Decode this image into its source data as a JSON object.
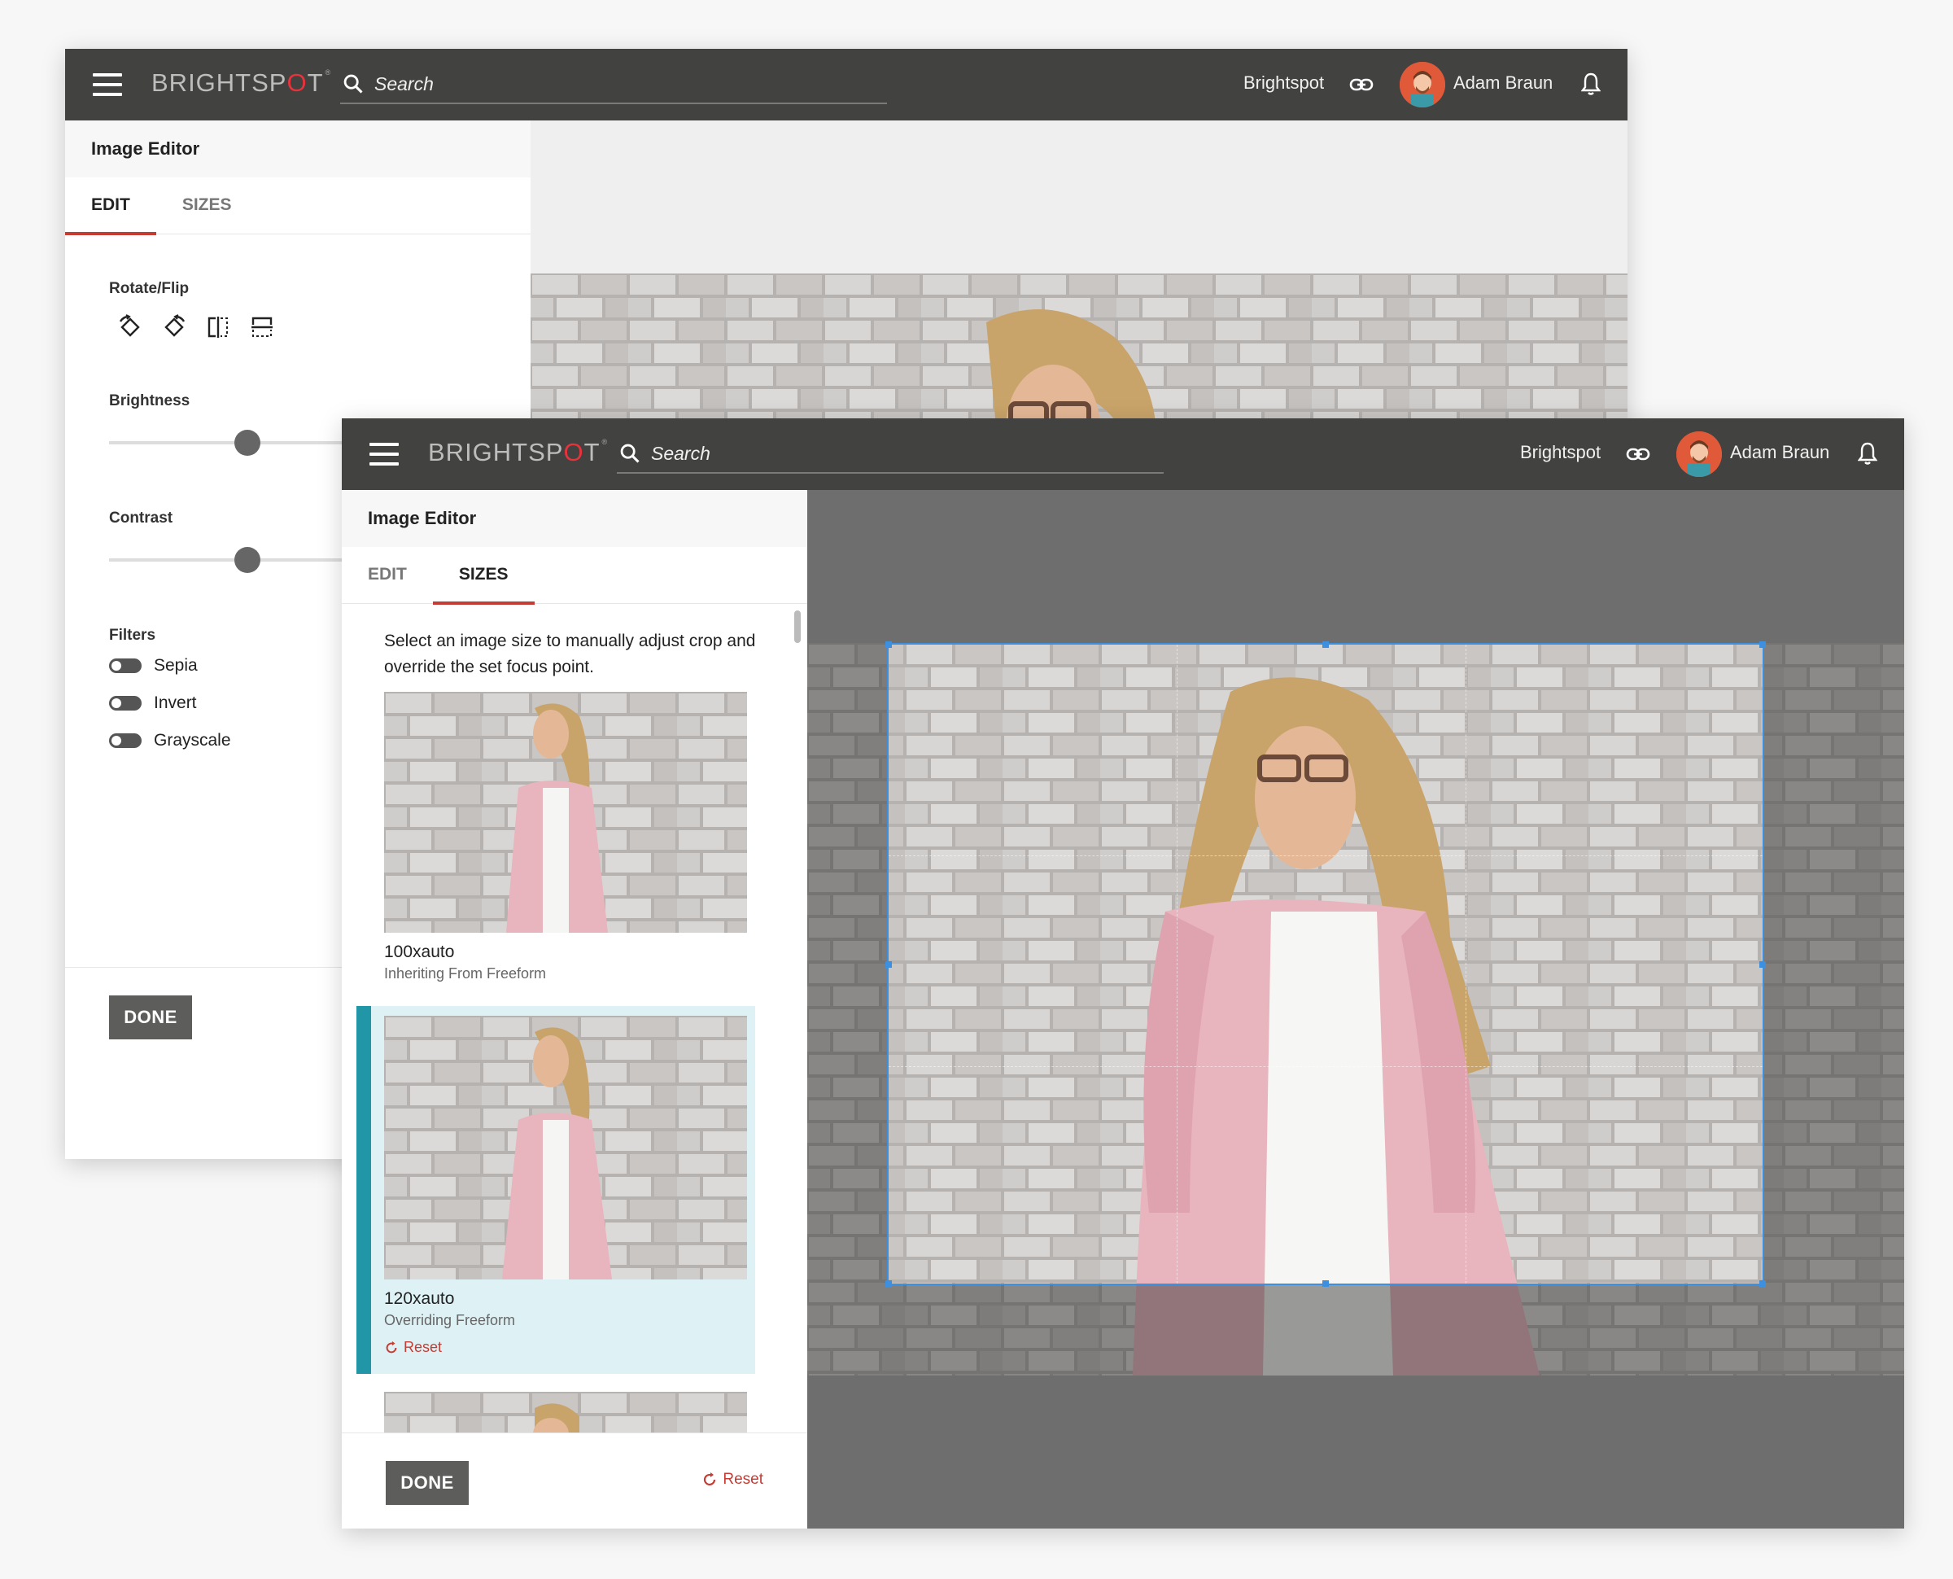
{
  "topbar": {
    "logo_prefix": "BRIGHTSP",
    "logo_o": "O",
    "logo_suffix": "T",
    "logo_mark": "®",
    "search_placeholder": "Search",
    "site_name": "Brightspot",
    "user_name": "Adam Braun"
  },
  "editor": {
    "title": "Image Editor",
    "tabs": [
      "EDIT",
      "SIZES"
    ],
    "rotate_label": "Rotate/Flip",
    "brightness_label": "Brightness",
    "brightness_value": 0.5,
    "contrast_label": "Contrast",
    "contrast_value": 0.5,
    "filters_label": "Filters",
    "filters": [
      "Sepia",
      "Invert",
      "Grayscale"
    ],
    "done_label": "DONE",
    "reset_label": "Reset"
  },
  "sizes": {
    "intro": "Select an image size to manually adjust crop and override the set focus point.",
    "items": [
      {
        "title": "100xauto",
        "subtitle": "Inheriting From Freeform"
      },
      {
        "title": "120xauto",
        "subtitle": "Overriding Freeform",
        "reset": "Reset"
      }
    ]
  },
  "icons": {
    "menu": "hamburger-icon",
    "search": "search-icon",
    "link": "link-icon",
    "bell": "bell-icon",
    "rotate_left": "rotate-left-icon",
    "rotate_right": "rotate-right-icon",
    "flip_h": "flip-horizontal-icon",
    "flip_v": "flip-vertical-icon",
    "reset": "reset-icon"
  },
  "colors": {
    "topbar": "#424240",
    "accent_tab": "#c43c33",
    "selected_bar": "#2196a6",
    "selected_bg": "#def2f6",
    "crop": "#3d8fe0"
  }
}
